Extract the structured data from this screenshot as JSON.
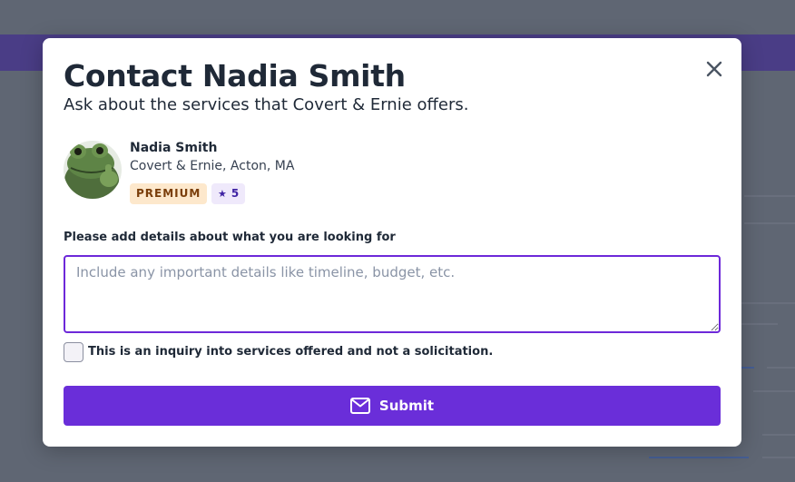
{
  "modal": {
    "title": "Contact Nadia Smith",
    "subtitle": "Ask about the services that Covert & Ernie offers.",
    "close_icon": "close-icon"
  },
  "pro": {
    "name": "Nadia Smith",
    "company_location": "Covert & Ernie, Acton, MA",
    "premium_badge": "PREMIUM",
    "rating": "5",
    "rating_icon": "star-icon"
  },
  "form": {
    "details_label": "Please add details about what you are looking for",
    "details_placeholder": "Include any important details like timeline, budget, etc.",
    "details_value": "",
    "disclaimer_label": "This is an inquiry into services offered and not a solicitation.",
    "disclaimer_checked": false,
    "submit_label": "Submit",
    "submit_icon": "mail-icon"
  },
  "colors": {
    "accent": "#6a2ed9",
    "premium_bg": "#fde8cc",
    "premium_text": "#7a3e0a",
    "rating_bg": "#efe9fb",
    "rating_text": "#3f23a3",
    "overlay": "#5f6673"
  }
}
